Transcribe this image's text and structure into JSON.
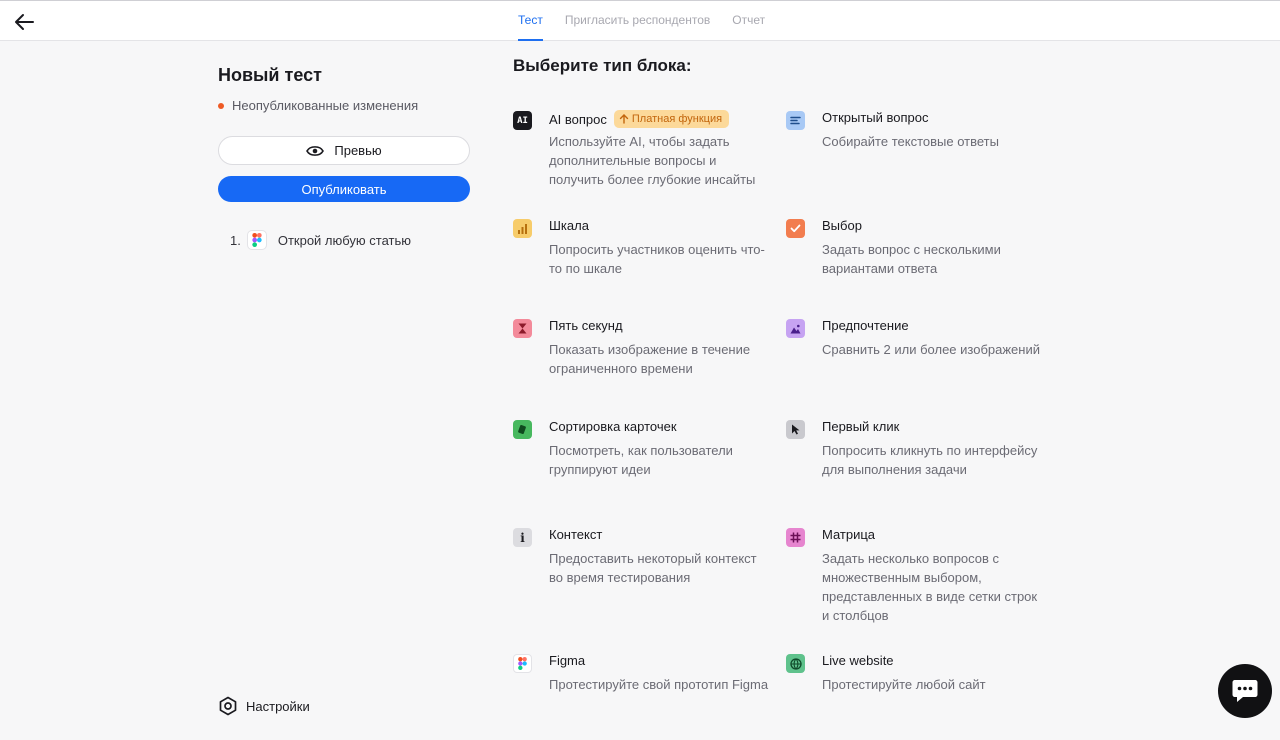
{
  "tabs": [
    {
      "label": "Тест",
      "active": true
    },
    {
      "label": "Пригласить респондентов",
      "active": false
    },
    {
      "label": "Отчет",
      "active": false
    }
  ],
  "sidebar": {
    "title": "Новый тест",
    "status": "Неопубликованные изменения",
    "status_color": "#ee5a24",
    "preview_label": "Превью",
    "publish_label": "Опубликовать",
    "steps": [
      {
        "number": "1.",
        "icon": "figma-icon",
        "label": "Открой любую статью"
      }
    ],
    "settings_label": "Настройки"
  },
  "main": {
    "title": "Выберите тип блока:",
    "paid_badge": "Платная функция",
    "blocks": [
      {
        "id": "ai",
        "title": "AI вопрос",
        "desc": "Используйте AI, чтобы задать дополнительные вопросы и получить более глубокие инсайты",
        "icon": "ai-icon",
        "icon_text": "AI",
        "color": "#1a1a1f"
      },
      {
        "id": "open",
        "title": "Открытый вопрос",
        "desc": "Собирайте текстовые ответы",
        "icon": "text-lines-icon",
        "color": "#8db8f2"
      },
      {
        "id": "scale",
        "title": "Шкала",
        "desc": "Попросить участников оценить что-то по шкале",
        "icon": "bar-chart-icon",
        "color": "#f7cc6a"
      },
      {
        "id": "choice",
        "title": "Выбор",
        "desc": "Задать вопрос с несколькими вариантами ответа",
        "icon": "checkbox-icon",
        "color": "#f27d4f"
      },
      {
        "id": "five",
        "title": "Пять секунд",
        "desc": "Показать изображение в течение ограниченного времени",
        "icon": "hourglass-icon",
        "color": "#f38a9a"
      },
      {
        "id": "pref",
        "title": "Предпочтение",
        "desc": "Сравнить 2 или более изображений",
        "icon": "image-icon",
        "color": "#c6a3f2"
      },
      {
        "id": "cards",
        "title": "Сортировка карточек",
        "desc": "Посмотреть, как пользователи группируют идеи",
        "icon": "cards-icon",
        "color": "#47b85e"
      },
      {
        "id": "click",
        "title": "Первый клик",
        "desc": "Попросить кликнуть по интерфейсу для выполнения задачи",
        "icon": "cursor-icon",
        "color": "#c9c9ce"
      },
      {
        "id": "context",
        "title": "Контекст",
        "desc": "Предоставить некоторый контекст во время тестирования",
        "icon": "info-icon",
        "color": "#dcdce0"
      },
      {
        "id": "matrix",
        "title": "Матрица",
        "desc": "Задать несколько вопросов с множественным выбором, представленных в виде сетки строк и столбцов",
        "icon": "hash-icon",
        "color": "#e685cf"
      },
      {
        "id": "figma",
        "title": "Figma",
        "desc": "Протестируйте свой прототип Figma",
        "icon": "figma-icon",
        "color": "#ffffff"
      },
      {
        "id": "live",
        "title": "Live website",
        "desc": "Протестируйте любой сайт",
        "icon": "globe-icon",
        "color": "#5fc28c"
      }
    ]
  }
}
